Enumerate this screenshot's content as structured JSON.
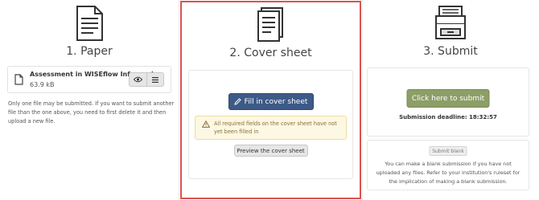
{
  "paper": {
    "title": "1. Paper",
    "icon": "document-icon",
    "file": {
      "name": "Assessment in WISEflow Infograph...",
      "size": "63.9 kB"
    },
    "note": "Only one file may be submitted. If you want to submit another file than the one above, you need to first delete it and then upload a new file."
  },
  "cover_sheet": {
    "title": "2. Cover sheet",
    "icon": "documents-stack-icon",
    "fill_button": "Fill in cover sheet",
    "warning": "All required fields on the cover sheet have not yet been filled in",
    "preview_button": "Preview the cover sheet",
    "highlight_color": "#d9534f"
  },
  "submit": {
    "title": "3. Submit",
    "icon": "inbox-tray-icon",
    "submit_button": "Click here to submit",
    "deadline": "Submission deadline: 18:32:57",
    "blank_button": "Submit blank",
    "blank_note": "You can make a blank submission if you have not uploaded any files. Refer to your institution's ruleset for the implication of making a blank submission."
  },
  "colors": {
    "primary": "#3d5a87",
    "submit": "#8d9e67",
    "warning_bg": "#fcf8e3",
    "warning_text": "#8a6d3b"
  }
}
